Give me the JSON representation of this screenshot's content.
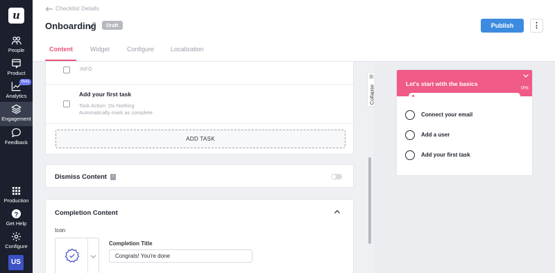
{
  "sidebar": {
    "logo": "u",
    "items": [
      {
        "label": "People",
        "icon": "people-icon"
      },
      {
        "label": "Product",
        "icon": "product-icon"
      },
      {
        "label": "Analytics",
        "icon": "analytics-icon",
        "badge": "Beta"
      },
      {
        "label": "Engagement",
        "icon": "layers-icon",
        "active": true
      },
      {
        "label": "Feedback",
        "icon": "chat-icon"
      },
      {
        "label": "Production",
        "icon": "grid-icon"
      },
      {
        "label": "Get Help",
        "icon": "help-icon"
      },
      {
        "label": "Configure",
        "icon": "gear-icon"
      }
    ],
    "avatar": "US"
  },
  "header": {
    "back_label": "Checklist Details",
    "title": "Onboarding",
    "status_badge": "Draft",
    "publish_label": "Publish",
    "more_label": "⋮"
  },
  "tabs": [
    {
      "label": "Content",
      "active": true
    },
    {
      "label": "Widget"
    },
    {
      "label": "Configure"
    },
    {
      "label": "Localization"
    }
  ],
  "tasks": {
    "info_label": "INFO",
    "task_title": "Add your first task",
    "task_action": "Task Action: Do Nothing",
    "task_auto": "Automatically mark as complete",
    "add_task_label": "ADD TASK"
  },
  "dismiss": {
    "title": "Dismiss Content",
    "info_icon": "i",
    "enabled": false
  },
  "completion": {
    "title": "Completion Content",
    "icon_label": "Icon",
    "completion_title_label": "Completion Title",
    "completion_title_value": "Congrats! You're done"
  },
  "collapse_label": "Collapse",
  "preview": {
    "title": "Let's start with the basics",
    "progress_percent": "0%",
    "progress": 0,
    "items": [
      "Connect your email",
      "Add a user",
      "Add your first task"
    ]
  },
  "colors": {
    "accent": "#e8537a",
    "preview_header": "#ef5a86",
    "publish": "#3d8be0",
    "sidebar": "#1b1f2e"
  }
}
